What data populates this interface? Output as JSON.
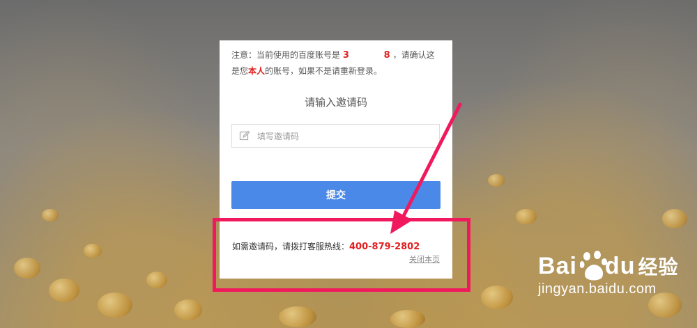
{
  "notice": {
    "prefix": "注意：当前使用的百度账号是",
    "account": "3           8",
    "suffix": "，请确认这",
    "line2_prefix": "是您",
    "self": "本人",
    "line2_suffix": "的账号，如果不是请重新登录。"
  },
  "form": {
    "title": "请输入邀请码",
    "input_placeholder": "填写邀请码",
    "submit_label": "提交"
  },
  "footer": {
    "hotline_label": "如需邀请码，请拨打客服热线：",
    "phone": "400-879-2802",
    "close_link": "关闭本页"
  },
  "watermark": {
    "logo_text": "Bai",
    "logo_text2": "du",
    "logo_cn": "经验",
    "url": "jingyan.baidu.com"
  },
  "colors": {
    "accent_red": "#e02020",
    "submit_blue": "#4a89e8",
    "highlight_pink": "#f0195e"
  }
}
